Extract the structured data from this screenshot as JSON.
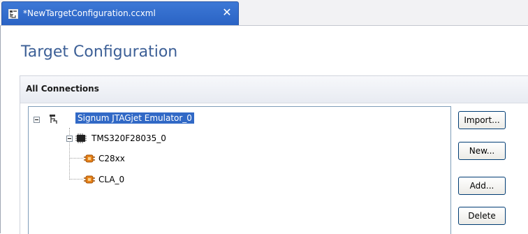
{
  "tab": {
    "title": "*NewTargetConfiguration.ccxml",
    "close": "✕",
    "icon": "target-config-file-icon"
  },
  "page": {
    "title": "Target Configuration"
  },
  "section": {
    "title": "All Connections"
  },
  "tree": {
    "nodes": [
      {
        "label": "Signum JTAGjet Emulator_0",
        "icon": "connection-icon",
        "selected": true
      },
      {
        "label": "TMS320F28035_0",
        "icon": "chip-icon"
      },
      {
        "label": "C28xx",
        "icon": "cpu-plug-icon"
      },
      {
        "label": "CLA_0",
        "icon": "cpu-plug-icon"
      }
    ]
  },
  "buttons": {
    "import": "Import...",
    "new": "New...",
    "add": "Add...",
    "delete": "Delete"
  },
  "colors": {
    "tab_active": "#2a63c4",
    "title": "#3c5f96",
    "selection": "#3169c6"
  }
}
